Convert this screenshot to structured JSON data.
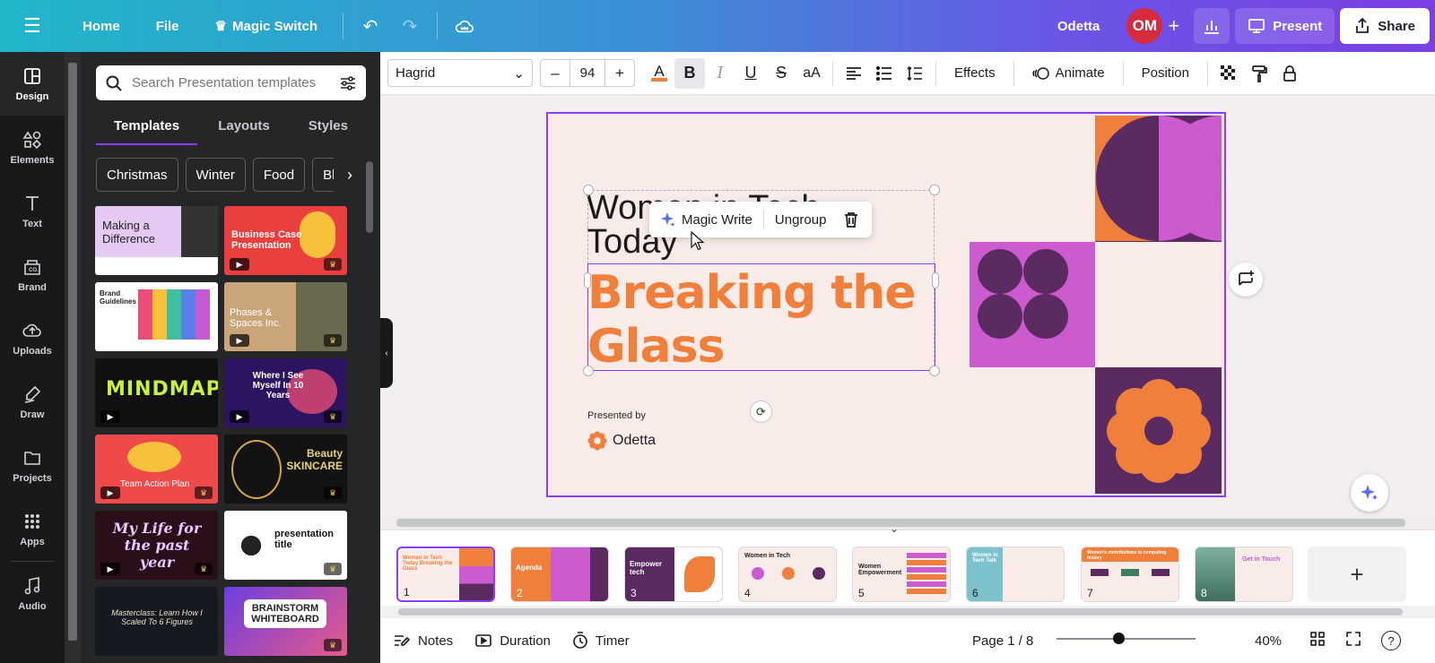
{
  "topbar": {
    "home": "Home",
    "file": "File",
    "magic_switch": "Magic Switch",
    "user_name": "Odetta",
    "avatar_initials": "OM",
    "present": "Present",
    "share": "Share"
  },
  "rail": {
    "items": [
      "Design",
      "Elements",
      "Text",
      "Brand",
      "Uploads",
      "Draw",
      "Projects",
      "Apps",
      "Audio"
    ]
  },
  "panel": {
    "search_placeholder": "Search Presentation templates",
    "tabs": [
      "Templates",
      "Layouts",
      "Styles"
    ],
    "chips": [
      "Christmas",
      "Winter",
      "Food",
      "Bl"
    ],
    "templates": [
      "Making a Difference",
      "Business Case Presentation",
      "Brand Guidelines",
      "Phases & Spaces Inc.",
      "MINDMAP",
      "Where I See Myself In 10 Years",
      "Team Action Plan",
      "Beauty SKINCARE",
      "My Life for the past year",
      "presentation title",
      "Masterclass: Learn How I Scaled To 6 Figures",
      "BRAINSTORM WHITEBOARD"
    ]
  },
  "toolbar": {
    "font": "Hagrid",
    "size": "94",
    "effects": "Effects",
    "animate": "Animate",
    "position": "Position"
  },
  "slide": {
    "small_title": "Women in Tech Today",
    "big_title": "Breaking the Glass",
    "presented_by": "Presented by",
    "brand": "Odetta"
  },
  "context_menu": {
    "magic_write": "Magic Write",
    "ungroup": "Ungroup"
  },
  "pages": {
    "thumbs": [
      {
        "num": "1",
        "label": "Women in Tech Today Breaking the Glass"
      },
      {
        "num": "2",
        "label": "Agenda"
      },
      {
        "num": "3",
        "label": "Empower tech"
      },
      {
        "num": "4",
        "label": "Women in Tech"
      },
      {
        "num": "5",
        "label": "Women Empowerment"
      },
      {
        "num": "6",
        "label": "Women in Tech Talk"
      },
      {
        "num": "7",
        "label": "Women's contributions to computing history"
      },
      {
        "num": "8",
        "label": "Get in Touch"
      }
    ]
  },
  "footer": {
    "notes": "Notes",
    "duration": "Duration",
    "timer": "Timer",
    "page": "Page 1 / 8",
    "zoom": "40%"
  },
  "colors": {
    "accent": "#8b3dff",
    "orange": "#ef7f3a",
    "purple_dark": "#5a2a60",
    "magenta": "#cc5bd0",
    "slide_bg": "#f8ebe8"
  }
}
